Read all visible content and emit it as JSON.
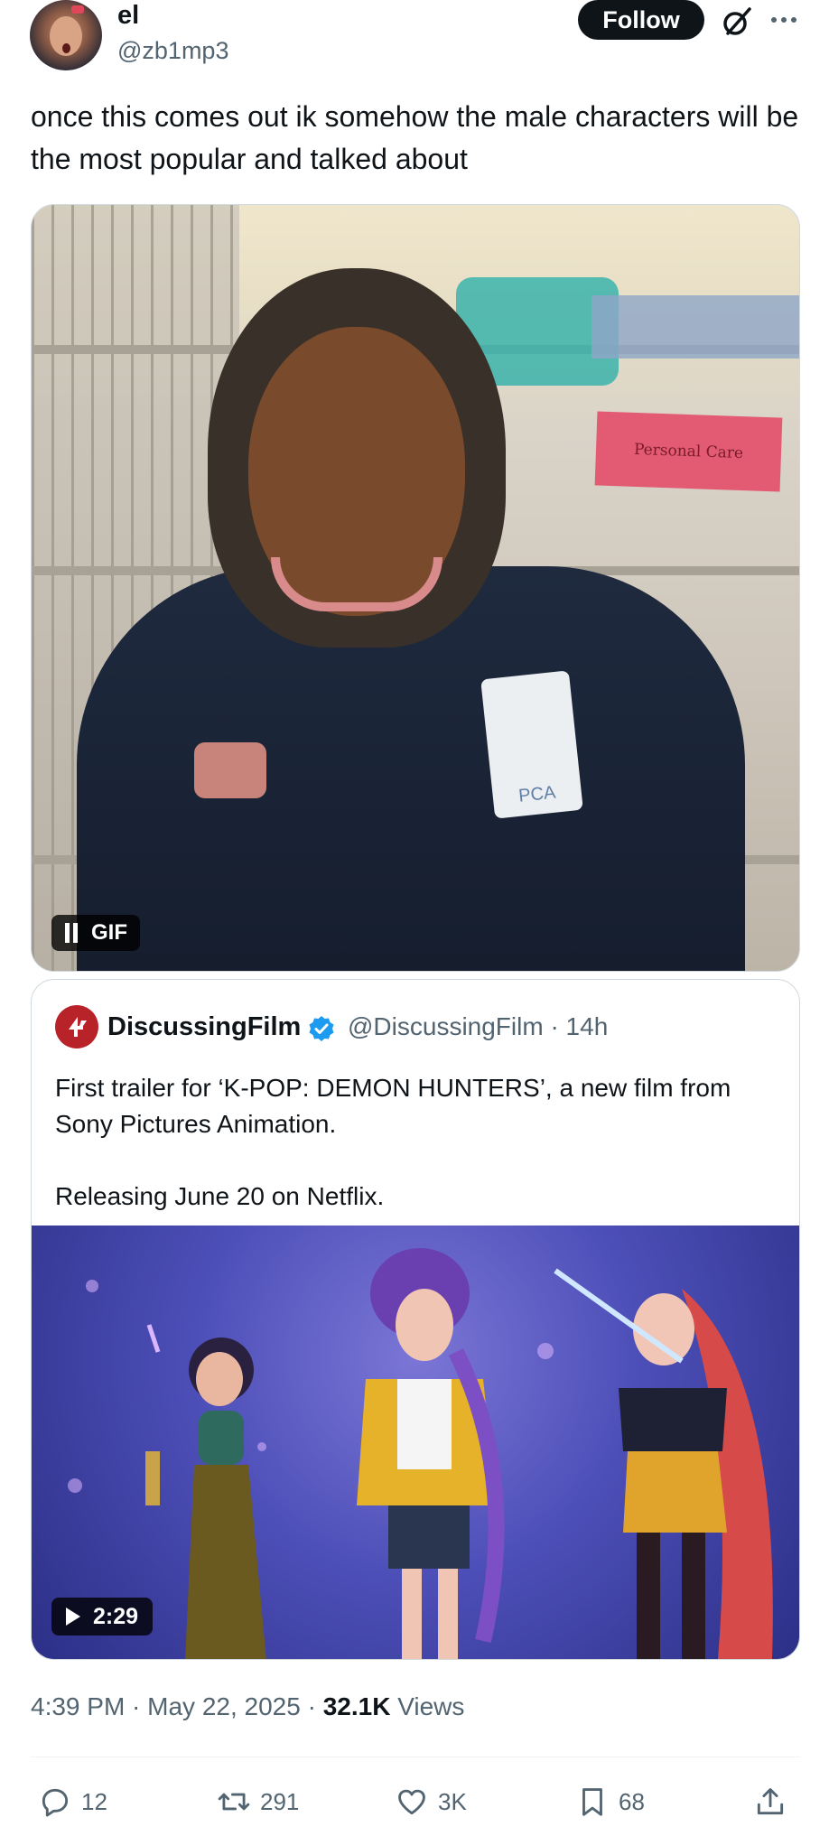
{
  "author": {
    "display_name": "el",
    "handle": "@zb1mp3",
    "follow_label": "Follow"
  },
  "tweet": {
    "text": "once this comes out ik somehow the male characters will be the most popular and talked about"
  },
  "gif_media": {
    "label": "GIF",
    "sign_text": "Personal Care",
    "badge_text": "PCA"
  },
  "quoted": {
    "display_name": "DiscussingFilm",
    "handle_time": "@DiscussingFilm · 14h",
    "line1": "First trailer for ‘K-POP: DEMON HUNTERS’, a new film from Sony Pictures Animation.",
    "line2": "Releasing June 20 on Netflix.",
    "video_duration": "2:29"
  },
  "meta": {
    "time_date": "4:39 PM · May 22, 2025 · ",
    "views_count": "32.1K",
    "views_label": " Views"
  },
  "actions": {
    "replies": "12",
    "reposts": "291",
    "likes": "3K",
    "bookmarks": "68"
  },
  "colors": {
    "text": "#0f1419",
    "secondary": "#536471",
    "verified": "#1d9bf0",
    "border": "#cfd9de"
  }
}
